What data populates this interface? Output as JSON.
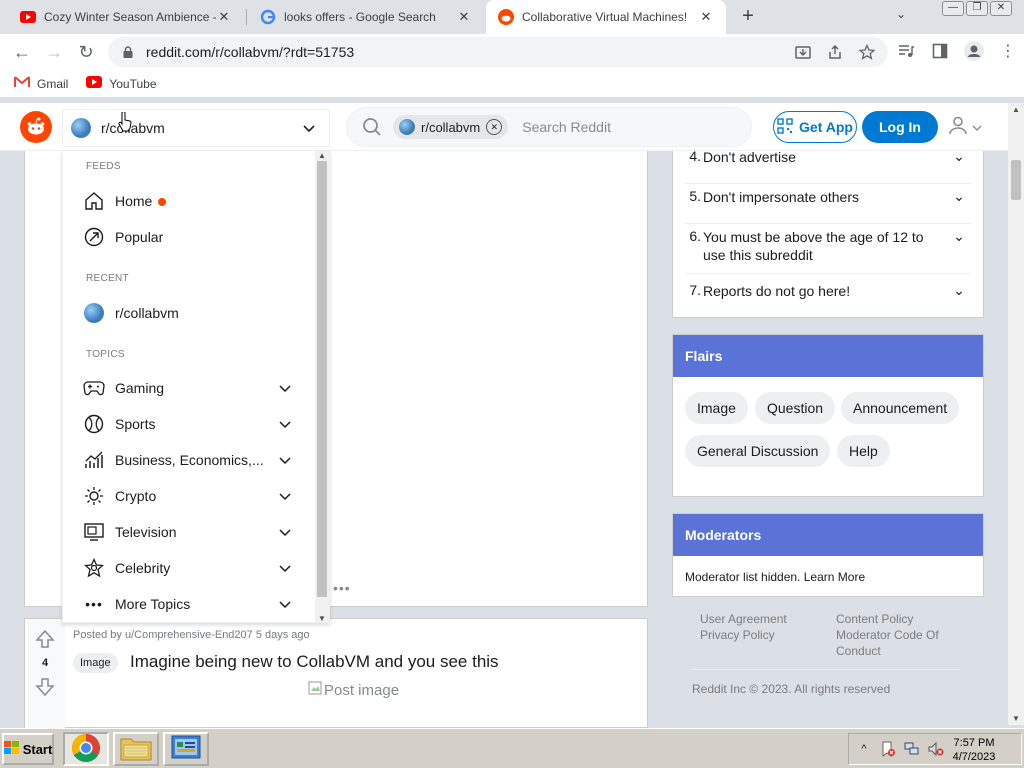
{
  "browser": {
    "tabs": [
      {
        "title": "Cozy Winter Season Ambience - A",
        "active": false
      },
      {
        "title": "looks offers - Google Search",
        "active": false
      },
      {
        "title": "Collaborative Virtual Machines!",
        "active": true
      }
    ],
    "url": "reddit.com/r/collabvm/?rdt=51753",
    "bookmarks": [
      {
        "label": "Gmail"
      },
      {
        "label": "YouTube"
      }
    ]
  },
  "reddit": {
    "community_selected": "r/collabvm",
    "search_chip": "r/collabvm",
    "search_placeholder": "Search Reddit",
    "get_app_label": "Get App",
    "login_label": "Log In"
  },
  "dropdown": {
    "feeds_heading": "FEEDS",
    "feeds": [
      {
        "label": "Home",
        "icon": "home-icon"
      },
      {
        "label": "Popular",
        "icon": "popular-icon"
      }
    ],
    "recent_heading": "RECENT",
    "recent": [
      {
        "label": "r/collabvm"
      }
    ],
    "topics_heading": "TOPICS",
    "topics": [
      {
        "label": "Gaming",
        "icon": "gamepad-icon"
      },
      {
        "label": "Sports",
        "icon": "ball-icon"
      },
      {
        "label": "Business, Economics,...",
        "icon": "chart-icon"
      },
      {
        "label": "Crypto",
        "icon": "crypto-icon"
      },
      {
        "label": "Television",
        "icon": "tv-icon"
      },
      {
        "label": "Celebrity",
        "icon": "star-icon"
      },
      {
        "label": "More Topics",
        "icon": "more-icon"
      }
    ]
  },
  "post": {
    "votes": "4",
    "posted_by": "Posted by u/Comprehensive-End207 5 days ago",
    "flair": "Image",
    "title": "Imagine being new to CollabVM and you see this",
    "image_alt": "Post image"
  },
  "rules": [
    {
      "num": "4.",
      "text": "Don't advertise"
    },
    {
      "num": "5.",
      "text": "Don't impersonate others"
    },
    {
      "num": "6.",
      "text": "You must be above the age of 12 to use this subreddit"
    },
    {
      "num": "7.",
      "text": "Reports do not go here!"
    }
  ],
  "flairs": {
    "heading": "Flairs",
    "items": [
      "Image",
      "Question",
      "Announcement",
      "General Discussion",
      "Help"
    ]
  },
  "moderators": {
    "heading": "Moderators",
    "text": "Moderator list hidden.",
    "learn_more": "Learn More"
  },
  "footer": {
    "col1": [
      "User Agreement",
      "Privacy Policy"
    ],
    "col2": [
      "Content Policy",
      "Moderator Code Of",
      "Conduct"
    ],
    "copyright": "Reddit Inc © 2023. All rights reserved"
  },
  "taskbar": {
    "start_label": "Start",
    "time": "7:57 PM",
    "date": "4/7/2023"
  },
  "colors": {
    "reddit_orange": "#ff4500",
    "reddit_blue": "#0079d3",
    "card_header": "#5b73d6"
  }
}
